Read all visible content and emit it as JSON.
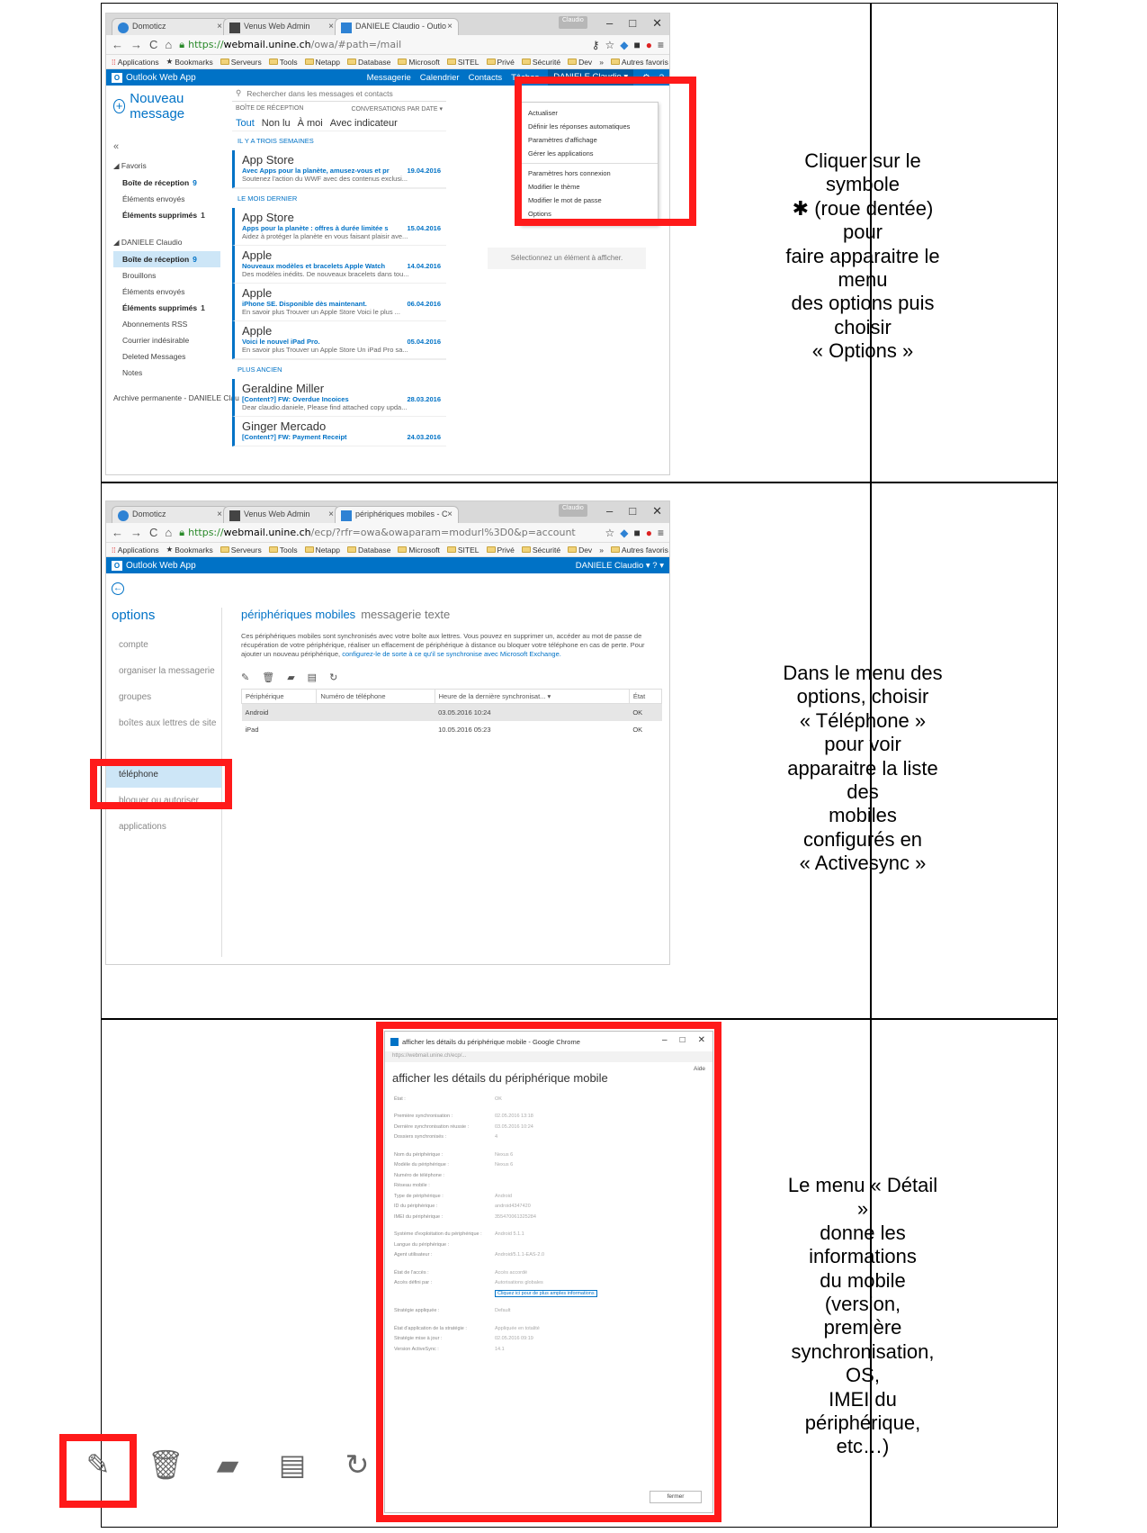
{
  "rows": [
    {
      "caption": "Cliquer sur le symbole\n✱ (roue dentée) pour\nfaire apparaitre le menu\ndes options puis choisir\n« Options »",
      "browser": {
        "tabs": [
          "Domoticz",
          "Venus Web Admin",
          "DANIELE Claudio - Outlo"
        ],
        "user_chip": "Claudio",
        "url_https": "https://",
        "url_host": "webmail.unine.ch",
        "url_path": "/owa/#path=/mail",
        "bookmarks": [
          "Applications",
          "Bookmarks",
          "Serveurs",
          "Tools",
          "Netapp",
          "Database",
          "Microsoft",
          "SITEL",
          "Privé",
          "Sécurité",
          "Dev",
          "»",
          "Autres favoris"
        ],
        "app_title": "Outlook Web App",
        "nav": [
          "Messagerie",
          "Calendrier",
          "Contacts",
          "Tâches"
        ],
        "user": "DANIELE Claudio ▾"
      },
      "new_message": "Nouveau message",
      "search_placeholder": "Rechercher dans les messages et contacts",
      "inbox_label": "BOÎTE DE RÉCEPTION",
      "sort_label": "CONVERSATIONS PAR DATE ▾",
      "filters": [
        "Tout",
        "Non lu",
        "À moi",
        "Avec indicateur"
      ],
      "collapse": "«",
      "favorites_head": "◢ Favoris",
      "favorites": [
        {
          "label": "Boîte de réception",
          "count": "9",
          "bold": true
        },
        {
          "label": "Éléments envoyés",
          "count": "",
          "bold": false
        },
        {
          "label": "Éléments supprimés",
          "count": "1",
          "bold": true
        }
      ],
      "account_head": "◢ DANIELE Claudio",
      "folders": [
        {
          "label": "Boîte de réception",
          "count": "9",
          "bold": true,
          "sel": true
        },
        {
          "label": "Brouillons",
          "count": "",
          "bold": false
        },
        {
          "label": "Éléments envoyés",
          "count": "",
          "bold": false
        },
        {
          "label": "Éléments supprimés",
          "count": "1",
          "bold": true
        },
        {
          "label": "Abonnements RSS",
          "count": "",
          "bold": false
        },
        {
          "label": "Courrier indésirable",
          "count": "",
          "bold": false
        },
        {
          "label": "Deleted Messages",
          "count": "",
          "bold": false
        },
        {
          "label": "Notes",
          "count": "",
          "bold": false
        }
      ],
      "archive": "Archive permanente - DANIELE Clau",
      "groups": [
        {
          "header": "IL Y A TROIS SEMAINES",
          "messages": [
            {
              "from": "App Store",
              "subject": "Avec Apps pour la planète, amusez-vous et pr",
              "date": "19.04.2016",
              "preview": "Soutenez l'action du WWF avec des contenus exclusi..."
            }
          ]
        },
        {
          "header": "LE MOIS DERNIER",
          "messages": [
            {
              "from": "App Store",
              "subject": "Apps pour la planète : offres à durée limitée s",
              "date": "15.04.2016",
              "preview": "Aidez à protéger la planète en vous faisant plaisir ave..."
            },
            {
              "from": "Apple",
              "subject": "Nouveaux modèles et bracelets Apple Watch",
              "date": "14.04.2016",
              "preview": "Des modèles inédits. De nouveaux bracelets dans tou..."
            },
            {
              "from": "Apple",
              "subject": "iPhone SE. Disponible dès maintenant.",
              "date": "06.04.2016",
              "preview": "En savoir plus Trouver un Apple Store   Voici le plus ..."
            },
            {
              "from": "Apple",
              "subject": "Voici le nouvel iPad Pro.",
              "date": "05.04.2016",
              "preview": "En savoir plus Trouver un Apple Store  Un iPad Pro sa..."
            }
          ]
        },
        {
          "header": "PLUS ANCIEN",
          "messages": [
            {
              "from": "Geraldine Miller",
              "subject": "[Content?] FW: Overdue Incoices",
              "date": "28.03.2016",
              "preview": "Dear claudio.daniele,  Please find attached copy upda..."
            },
            {
              "from": "Ginger Mercado",
              "subject": "[Content?] FW: Payment Receipt",
              "date": "24.03.2016",
              "preview": ""
            }
          ]
        }
      ],
      "reading_pane": "Sélectionnez un élément à afficher.",
      "menu": [
        "Actualiser",
        "Définir les réponses automatiques",
        "Paramètres d'affichage",
        "Gérer les applications",
        "Paramètres hors connexion",
        "Modifier le thème",
        "Modifier le mot de passe",
        "Options"
      ]
    },
    {
      "caption": "Dans le menu des\noptions, choisir\n« Téléphone » pour voir\napparaitre la liste des\nmobiles configurés en\n« Activesync »",
      "browser": {
        "tabs": [
          "Domoticz",
          "Venus Web Admin",
          "périphériques mobiles - C"
        ],
        "user_chip": "Claudio",
        "url_https": "https://",
        "url_host": "webmail.unine.ch",
        "url_path": "/ecp/?rfr=owa&owaparam=modurl%3D0&p=account",
        "bookmarks": [
          "Applications",
          "Bookmarks",
          "Serveurs",
          "Tools",
          "Netapp",
          "Database",
          "Microsoft",
          "SITEL",
          "Privé",
          "Sécurité",
          "Dev",
          "»",
          "Autres favoris"
        ],
        "app_title": "Outlook Web App",
        "user": "DANIELE Claudio ▾   ? ▾"
      },
      "options_title": "options",
      "nav": [
        {
          "label": "compte",
          "sel": false
        },
        {
          "label": "organiser la messagerie",
          "sel": false
        },
        {
          "label": "groupes",
          "sel": false
        },
        {
          "label": "boîtes aux lettres de site",
          "sel": false
        },
        {
          "label": "",
          "sel": false
        },
        {
          "label": "téléphone",
          "sel": true
        },
        {
          "label": "bloquer ou autoriser",
          "sel": false
        },
        {
          "label": "applications",
          "sel": false
        }
      ],
      "tab_active": "périphériques mobiles",
      "tab_other": "messagerie texte",
      "description": "Ces périphériques mobiles sont synchronisés avec votre boîte aux lettres. Vous pouvez en supprimer un, accéder au mot de passe de récupération de votre périphérique, réaliser un effacement de périphérique à distance ou bloquer votre téléphone en cas de perte. Pour ajouter un nouveau périphérique,",
      "description_link": "configurez-le de sorte à ce qu'il se synchronise avec Microsoft Exchange.",
      "columns": [
        "Périphérique",
        "Numéro de téléphone",
        "Heure de la dernière synchronisat... ▾",
        "État"
      ],
      "devices": [
        {
          "name": "Android",
          "phone": "",
          "last_sync": "03.05.2016 10:24",
          "state": "OK",
          "sel": true
        },
        {
          "name": "iPad",
          "phone": "",
          "last_sync": "10.05.2016 05:23",
          "state": "OK",
          "sel": false
        }
      ]
    },
    {
      "caption": "Le menu « Détail »\ndonne les informations\ndu mobile (version,\npremière\nsynchronisation, OS,\nIMEI du périphérique,\netc…)",
      "window_title": "afficher les détails du périphérique mobile - Google Chrome",
      "url": "https://webmail.unine.ch/ecp/...",
      "help": "Aide",
      "heading": "afficher les détails du périphérique mobile",
      "fields": [
        {
          "k": "État :",
          "v": "OK"
        },
        {
          "k": "",
          "v": ""
        },
        {
          "k": "Première synchronisation :",
          "v": "02.05.2016 13:18"
        },
        {
          "k": "Dernière synchronisation réussie :",
          "v": "03.05.2016 10:24"
        },
        {
          "k": "Dossiers synchronisés :",
          "v": "4"
        },
        {
          "k": "",
          "v": ""
        },
        {
          "k": "Nom du périphérique :",
          "v": "Nexus 6"
        },
        {
          "k": "Modèle du périphérique :",
          "v": "Nexus 6"
        },
        {
          "k": "Numéro de téléphone :",
          "v": ""
        },
        {
          "k": "Réseau mobile :",
          "v": ""
        },
        {
          "k": "Type de périphérique :",
          "v": "Android"
        },
        {
          "k": "ID du périphérique :",
          "v": "android4347420"
        },
        {
          "k": "IMEI du périphérique :",
          "v": "355470061325284"
        },
        {
          "k": "",
          "v": ""
        },
        {
          "k": "Système d'exploitation du périphérique :",
          "v": "Android 5.1.1"
        },
        {
          "k": "Langue du périphérique :",
          "v": ""
        },
        {
          "k": "Agent utilisateur :",
          "v": "Android/5.1.1-EAS-2.0"
        },
        {
          "k": "",
          "v": ""
        },
        {
          "k": "État de l'accès :",
          "v": "Accès accordé"
        },
        {
          "k": "Accès défini par :",
          "v": "Autorisations globales"
        }
      ],
      "more_link": "Cliquez ici pour de plus amples informations",
      "fields2": [
        {
          "k": "Stratégie appliquée :",
          "v": "Default"
        },
        {
          "k": "",
          "v": ""
        },
        {
          "k": "État d'application de la stratégie :",
          "v": "Appliquée en totalité"
        },
        {
          "k": "Stratégie mise à jour :",
          "v": "02.05.2016 09:19"
        },
        {
          "k": "Version ActiveSync :",
          "v": "14.1"
        }
      ],
      "close": "fermer",
      "tool_icons": [
        "pencil-icon",
        "trash-icon",
        "wipe-icon",
        "details-icon",
        "refresh-icon"
      ]
    }
  ]
}
